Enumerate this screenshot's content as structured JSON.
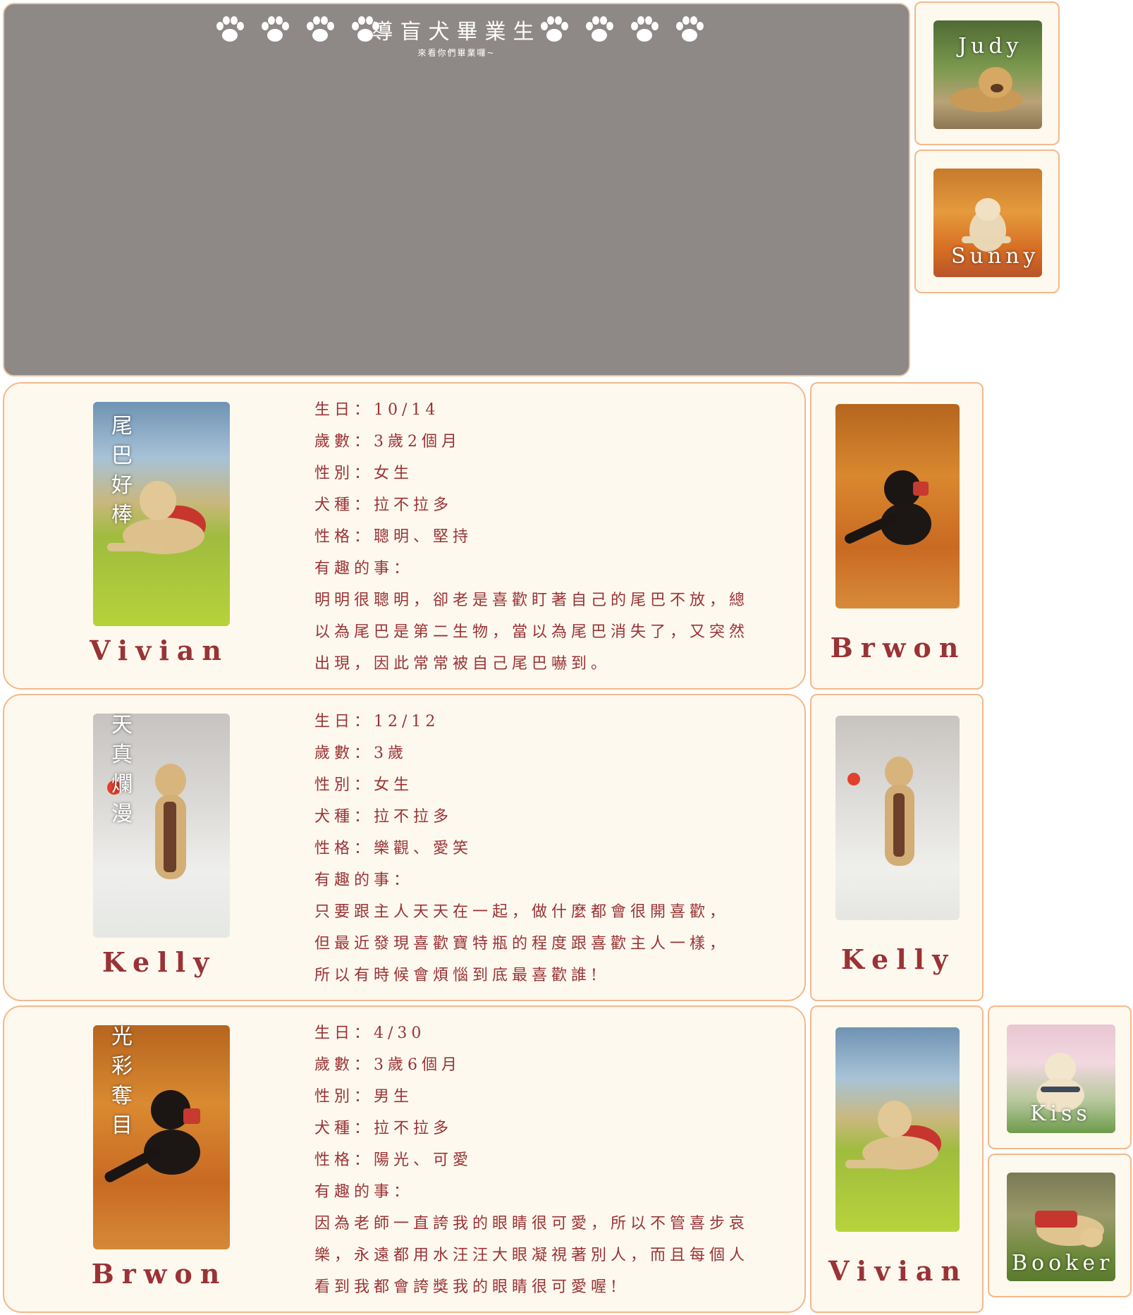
{
  "banner": {
    "title": "導盲犬畢業生",
    "subtitle": "來看你們畢業囉~"
  },
  "thumbnails": [
    {
      "label": "Judy"
    },
    {
      "label": "Sunny"
    },
    {
      "label": "Kiss"
    },
    {
      "label": "Booker"
    }
  ],
  "profiles": [
    {
      "name": "Vivian",
      "nickname": "尾巴好棒",
      "lines": [
        "生日：10/14",
        "歲數：3歲2個月",
        "性別：女生",
        "犬種：拉不拉多",
        "性格：聰明、堅持",
        "有趣的事：",
        "明明很聰明，卻老是喜歡盯著自己的尾巴不放，總",
        "以為尾巴是第二生物，當以為尾巴消失了，又突然",
        "出現，因此常常被自己尾巴嚇到。"
      ]
    },
    {
      "name": "Kelly",
      "nickname": "天真爛漫",
      "lines": [
        "生日：12/12",
        "歲數：3歲",
        "性別：女生",
        "犬種：拉不拉多",
        "性格：樂觀、愛笑",
        "有趣的事：",
        "只要跟主人天天在一起，做什麼都會很開喜歡，",
        "但最近發現喜歡寶特瓶的程度跟喜歡主人一樣，",
        "所以有時候會煩惱到底最喜歡誰!"
      ]
    },
    {
      "name": "Brwon",
      "nickname": "光彩奪目",
      "lines": [
        "生日：4/30",
        "歲數：3歲6個月",
        "性別：男生",
        "犬種：拉不拉多",
        "性格：陽光、可愛",
        "有趣的事：",
        "因為老師一直誇我的眼睛很可愛，所以不管喜步哀",
        "樂，永遠都用水汪汪大眼凝視著別人，而且每個人",
        "看到我都會誇獎我的眼睛很可愛喔!"
      ]
    }
  ],
  "side_cards": [
    {
      "name": "Brwon"
    },
    {
      "name": "Kelly"
    },
    {
      "name": "Vivian"
    }
  ]
}
